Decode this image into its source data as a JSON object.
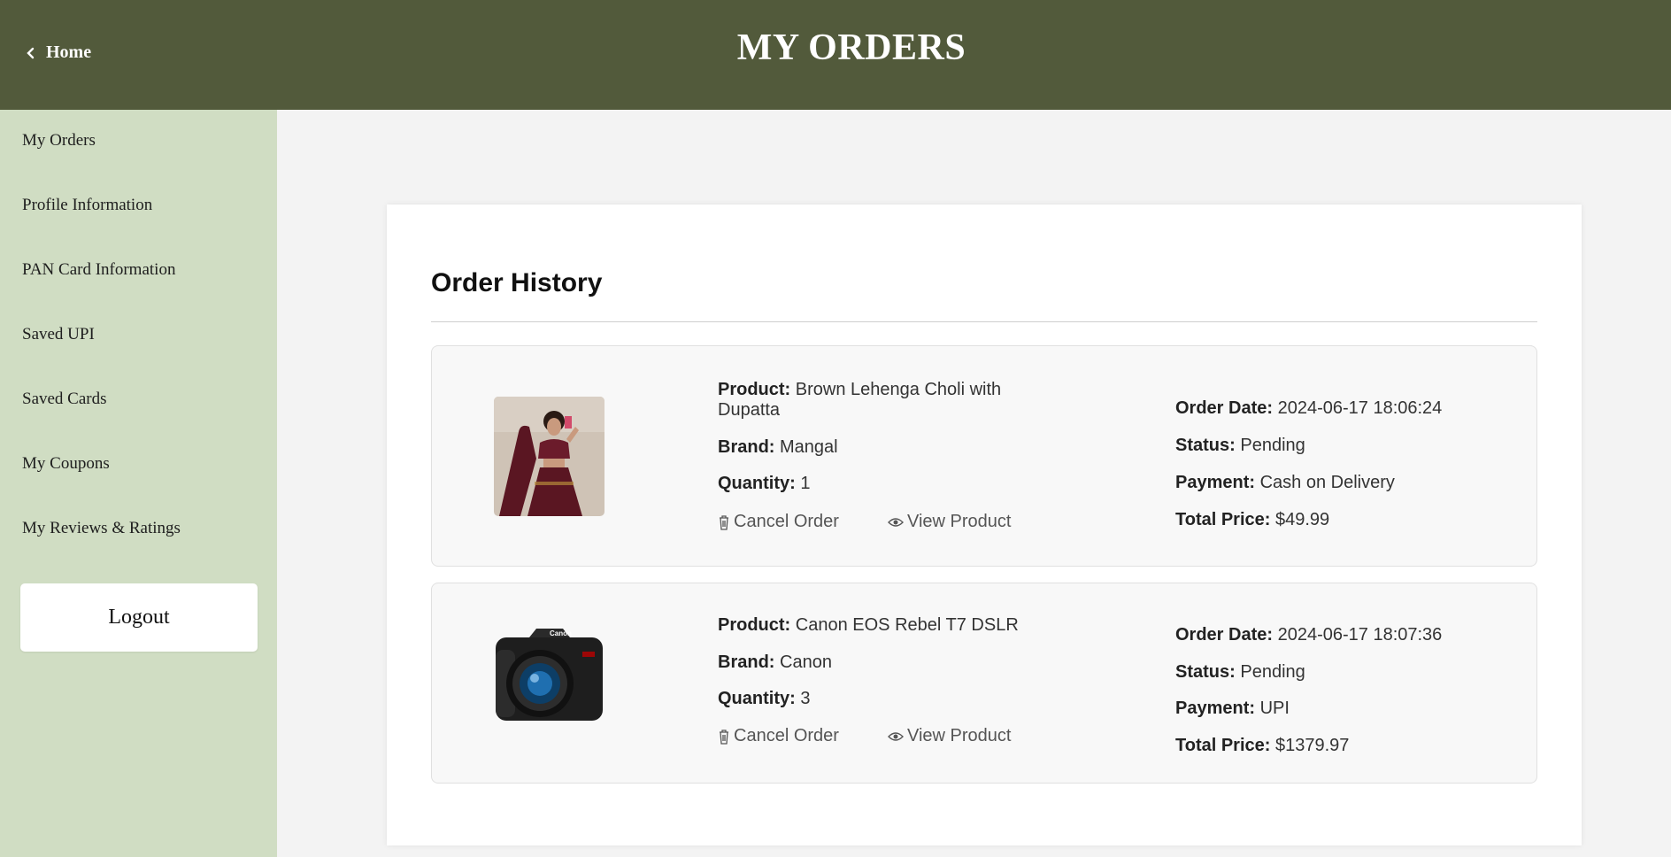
{
  "header": {
    "back_label": "Home",
    "title": "MY ORDERS"
  },
  "sidebar": {
    "items": [
      {
        "label": "My Orders"
      },
      {
        "label": "Profile Information"
      },
      {
        "label": "PAN Card Information"
      },
      {
        "label": "Saved UPI"
      },
      {
        "label": "Saved Cards"
      },
      {
        "label": "My Coupons"
      },
      {
        "label": "My Reviews & Ratings"
      }
    ],
    "logout_label": "Logout"
  },
  "main": {
    "heading": "Order History",
    "labels": {
      "product": "Product:",
      "brand": "Brand:",
      "quantity": "Quantity:",
      "order_date": "Order Date:",
      "status": "Status:",
      "payment": "Payment:",
      "total_price": "Total Price:",
      "cancel": "Cancel Order",
      "view": "View Product"
    },
    "orders": [
      {
        "product": "Brown Lehenga Choli with Dupatta",
        "product_line1": "Brown Lehenga Choli with",
        "product_line2": "Dupatta",
        "brand": "Mangal",
        "quantity": "1",
        "order_date": "2024-06-17 18:06:24",
        "status": "Pending",
        "payment": "Cash on Delivery",
        "total_price": "$49.99",
        "image_icon": "lehenga-photo"
      },
      {
        "product": "Canon EOS Rebel T7 DSLR",
        "brand": "Canon",
        "quantity": "3",
        "order_date": "2024-06-17 18:07:36",
        "status": "Pending",
        "payment": "UPI",
        "total_price": "$1379.97",
        "image_icon": "camera-photo",
        "camera_brand_text": "Canon"
      }
    ]
  },
  "colors": {
    "header_bg": "#525a3b",
    "sidebar_bg": "#d0ddc3",
    "page_bg": "#f3f3f3",
    "card_bg": "#f8f8f8"
  }
}
